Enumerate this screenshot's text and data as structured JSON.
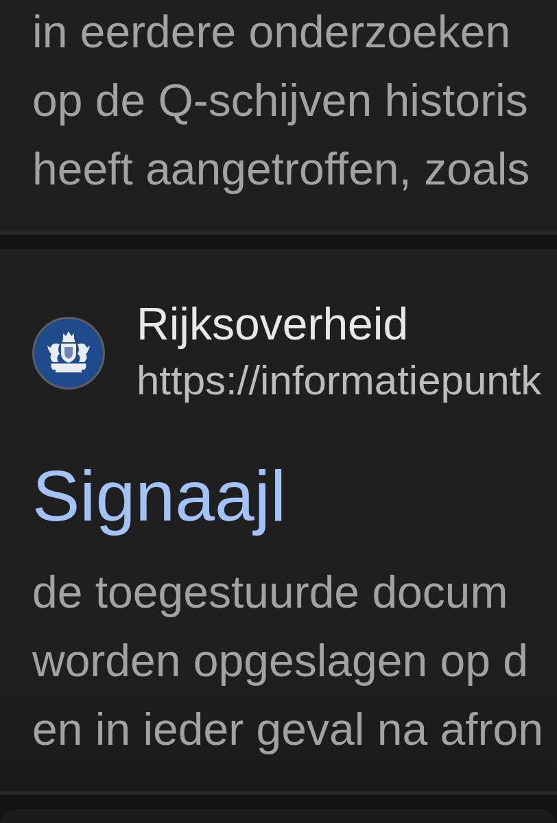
{
  "results": [
    {
      "snippet": [
        "in eerdere onderzoeken",
        "op de Q-schijven historis",
        "heeft aangetroffen, zoals"
      ]
    },
    {
      "site_name": "Rijksoverheid",
      "url": "https://informatiepuntk",
      "title": "Signaajl",
      "snippet": [
        "de toegestuurde docum",
        "worden opgeslagen op d",
        "en in ieder geval na afron"
      ]
    }
  ]
}
